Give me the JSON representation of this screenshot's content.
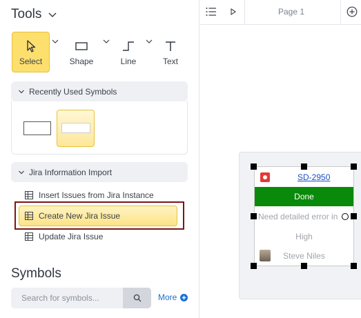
{
  "tools": {
    "title": "Tools",
    "items": [
      {
        "label": "Select",
        "icon": "cursor-arrow-icon"
      },
      {
        "label": "Shape",
        "icon": "rectangle-icon"
      },
      {
        "label": "Line",
        "icon": "line-elbow-icon"
      },
      {
        "label": "Text",
        "icon": "text-t-icon"
      }
    ]
  },
  "recent": {
    "title": "Recently Used Symbols"
  },
  "jira": {
    "title": "Jira Information Import",
    "items": [
      {
        "label": "Insert Issues from Jira Instance"
      },
      {
        "label": "Create New Jira Issue"
      },
      {
        "label": "Update Jira Issue"
      }
    ]
  },
  "symbols": {
    "title": "Symbols",
    "search_placeholder": "Search for symbols...",
    "more_label": "More"
  },
  "tabs": {
    "page_label": "Page 1"
  },
  "card": {
    "issue_key": "SD-2950",
    "status": "Done",
    "summary": "Need detailed error in",
    "priority": "High",
    "assignee": "Steve Niles"
  },
  "colors": {
    "accent_yellow": "#fddf6e",
    "status_green": "#0a8a0a",
    "link_blue": "#1a6fd3",
    "highlight_outline": "#7a1515"
  }
}
